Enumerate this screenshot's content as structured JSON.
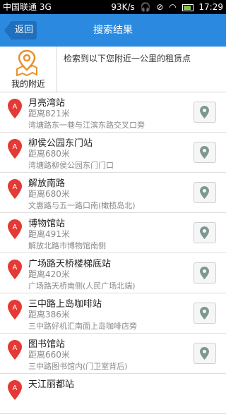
{
  "status_bar": {
    "carrier": "中国联通 3G",
    "speed": "93K/s",
    "time": "17:29",
    "colors": {
      "battery": "#7ec342"
    }
  },
  "header": {
    "back_label": "返回",
    "title": "搜索结果",
    "colors": {
      "bar": "#2b8ae0",
      "back": "#1f6fbe"
    }
  },
  "nearby": {
    "button_label": "我的附近",
    "info_text": "检索到以下您附近一公里的租赁点",
    "icon": "map-location-pin-icon",
    "colors": {
      "icon": "#e8912b"
    }
  },
  "stations": [
    {
      "name": "月亮湾站",
      "distance": "距离821米",
      "address": "湾塘路东一巷与江滨东路交叉口旁"
    },
    {
      "name": "柳侯公园东门站",
      "distance": "距离680米",
      "address": "湾塘路柳侯公园东门门口"
    },
    {
      "name": "解放南路",
      "distance": "距离680米",
      "address": "文惠路与五一路口南(橄榄岛北)"
    },
    {
      "name": "博物馆站",
      "distance": "距离491米",
      "address": "解放北路市博物馆南侧"
    },
    {
      "name": "广场路天桥楼梯底站",
      "distance": "距离420米",
      "address": "广场路天桥南侧(人民广场北端)"
    },
    {
      "name": "三中路上岛咖啡站",
      "distance": "距离386米",
      "address": "三中路好机汇南面上岛咖啡店旁"
    },
    {
      "name": "图书馆站",
      "distance": "距离660米",
      "address": "三中路图书馆内(门卫室背后)"
    },
    {
      "name": "天江丽都站",
      "distance": "",
      "address": ""
    }
  ],
  "list_icons": {
    "marker": "red-marker-a-icon",
    "map": "map-location-icon",
    "marker_letter": "A"
  },
  "list_colors": {
    "marker": "#e53935",
    "map_icon": "#7d9892"
  }
}
